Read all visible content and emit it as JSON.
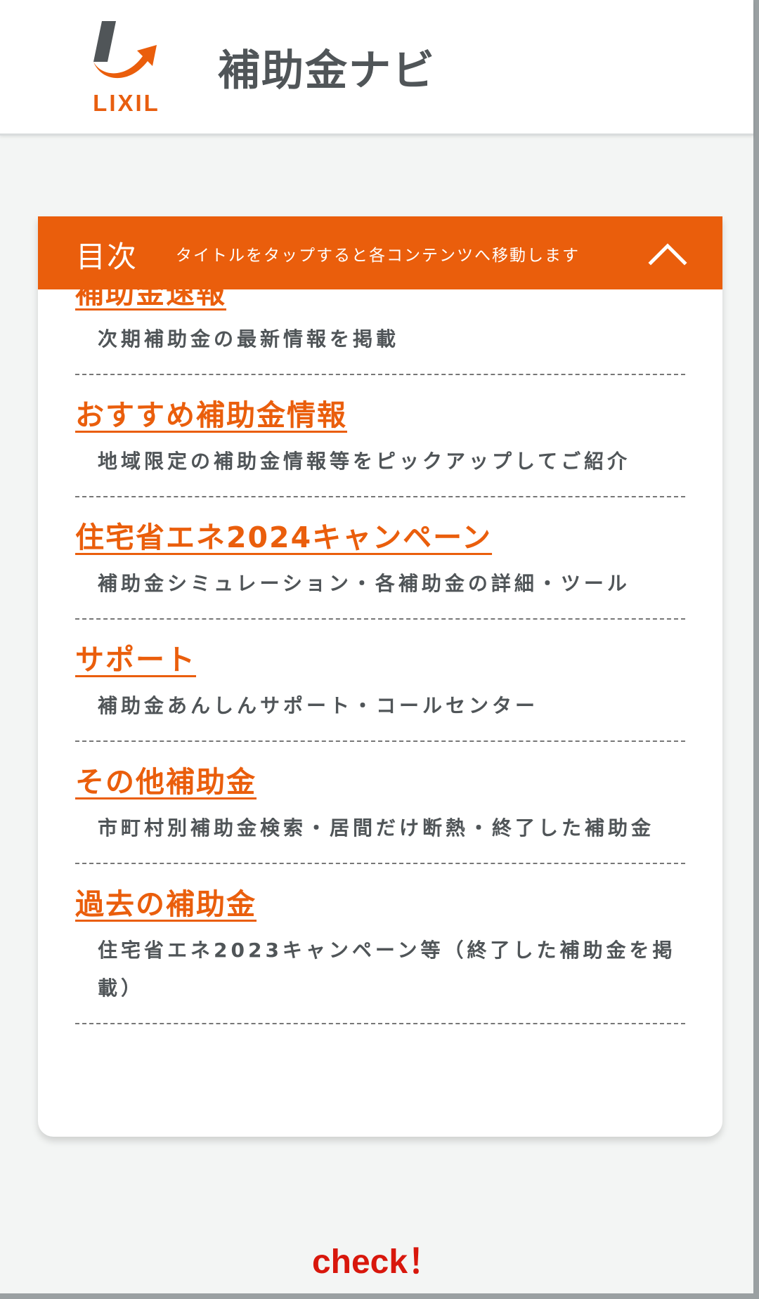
{
  "header": {
    "logo_text": "LIXIL",
    "title": "補助金ナビ"
  },
  "toc": {
    "title": "目次",
    "hint": "タイトルをタップすると各コンテンツへ移動します",
    "items": [
      {
        "label": "補助金速報",
        "desc": "次期補助金の最新情報を掲載"
      },
      {
        "label": "おすすめ補助金情報",
        "desc": "地域限定の補助金情報等をピックアップしてご紹介"
      },
      {
        "label": "住宅省エネ2024キャンペーン",
        "desc": "補助金シミュレーション・各補助金の詳細・ツール"
      },
      {
        "label": "サポート",
        "desc": "補助金あんしんサポート・コールセンター"
      },
      {
        "label": "その他補助金",
        "desc": "市町村別補助金検索・居間だけ断熱・終了した補助金"
      },
      {
        "label": "過去の補助金",
        "desc": "住宅省エネ2023キャンペーン等（終了した補助金を掲載）"
      }
    ]
  },
  "footer": {
    "check": "check！"
  },
  "colors": {
    "brand_orange": "#ea5e0c",
    "text_gray": "#505558",
    "check_red": "#d8170c"
  }
}
